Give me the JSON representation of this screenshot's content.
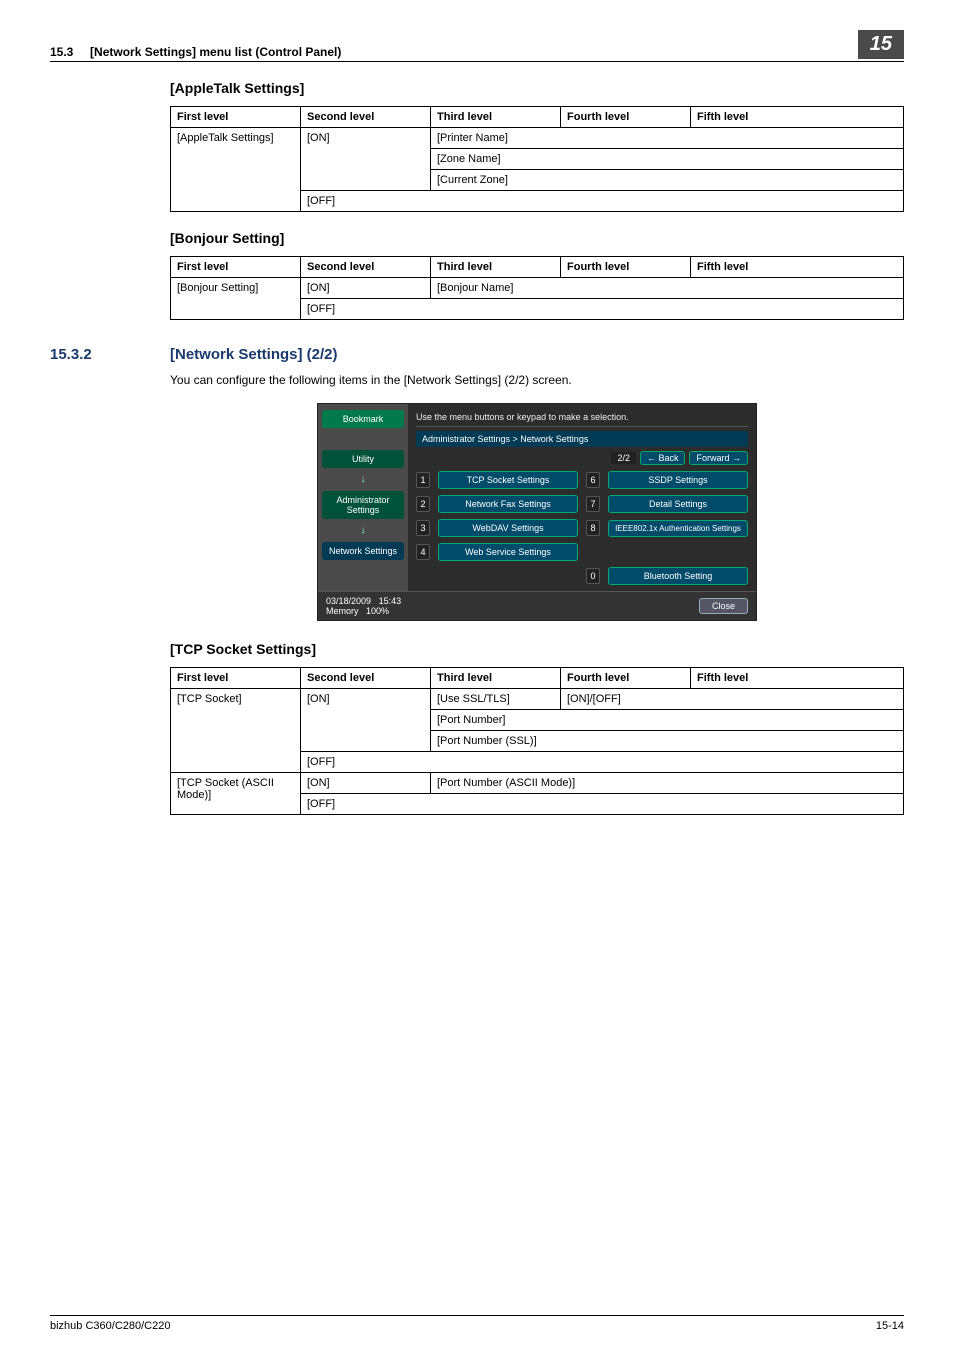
{
  "header": {
    "section_num": "15.3",
    "section_title": "[Network Settings] menu list (Control Panel)",
    "chapter": "15"
  },
  "appletalk": {
    "heading": "[AppleTalk Settings]",
    "cols": [
      "First level",
      "Second level",
      "Third level",
      "Fourth level",
      "Fifth level"
    ],
    "first": "[AppleTalk Settings]",
    "on": "[ON]",
    "r1": "[Printer Name]",
    "r2": "[Zone Name]",
    "r3": "[Current Zone]",
    "off": "[OFF]"
  },
  "bonjour": {
    "heading": "[Bonjour Setting]",
    "cols": [
      "First level",
      "Second level",
      "Third level",
      "Fourth level",
      "Fifth level"
    ],
    "first": "[Bonjour Setting]",
    "on": "[ON]",
    "r1": "[Bonjour Name]",
    "off": "[OFF]"
  },
  "section": {
    "num": "15.3.2",
    "title": "[Network Settings] (2/2)",
    "body": "You can configure the following items in the [Network Settings] (2/2) screen."
  },
  "screenshot": {
    "hint": "Use the menu buttons or keypad to make a selection.",
    "crumb": "Administrator Settings > Network Settings",
    "page": "2/2",
    "back": "← Back",
    "fwd": "Forward →",
    "left_tabs": [
      "Bookmark",
      "Utility",
      "Administrator Settings",
      "Network Settings"
    ],
    "items": [
      {
        "n": "1",
        "label": "TCP Socket Settings"
      },
      {
        "n": "2",
        "label": "Network Fax Settings"
      },
      {
        "n": "3",
        "label": "WebDAV Settings"
      },
      {
        "n": "4",
        "label": "Web Service Settings"
      },
      {
        "n": "6",
        "label": "SSDP Settings"
      },
      {
        "n": "7",
        "label": "Detail Settings"
      },
      {
        "n": "8",
        "label": "IEEE802.1x Authentication Settings"
      },
      {
        "n": "0",
        "label": "Bluetooth Setting"
      }
    ],
    "date": "03/18/2009",
    "time": "15:43",
    "mem_label": "Memory",
    "mem_val": "100%",
    "close": "Close"
  },
  "tcpsocket": {
    "heading": "[TCP Socket Settings]",
    "cols": [
      "First level",
      "Second level",
      "Third level",
      "Fourth level",
      "Fifth level"
    ],
    "first1": "[TCP Socket]",
    "on": "[ON]",
    "r1c3": "[Use SSL/TLS]",
    "r1c4": "[ON]/[OFF]",
    "r2": "[Port Number]",
    "r3": "[Port Number (SSL)]",
    "off": "[OFF]",
    "first2": "[TCP Socket (ASCII Mode)]",
    "r4": "[Port Number (ASCII Mode)]"
  },
  "footer": {
    "left": "bizhub C360/C280/C220",
    "right": "15-14"
  }
}
